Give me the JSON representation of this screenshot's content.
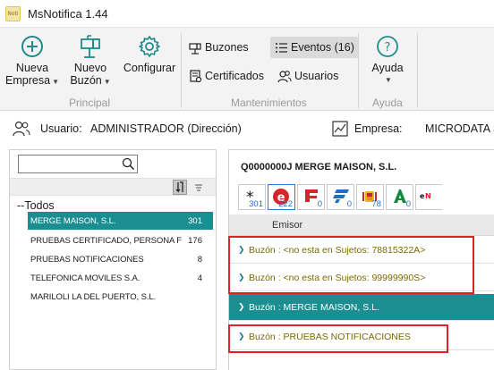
{
  "window": {
    "title": "MsNotifica 1.44",
    "icon_text": "Noti"
  },
  "ribbon": {
    "principal": {
      "label": "Principal",
      "nueva_empresa": {
        "line1": "Nueva",
        "line2": "Empresa"
      },
      "nuevo_buzon": {
        "line1": "Nuevo",
        "line2": "Buzón"
      },
      "configurar": {
        "label": "Configurar"
      }
    },
    "mantenimientos": {
      "label": "Mantenimientos",
      "buzones": "Buzones",
      "certificados": "Certificados",
      "eventos": "Eventos (16)",
      "usuarios": "Usuarios"
    },
    "ayuda": {
      "label": "Ayuda",
      "button": "Ayuda"
    }
  },
  "infobar": {
    "usuario_label": "Usuario:",
    "usuario_value": "ADMINISTRADOR (Dirección)",
    "empresa_label": "Empresa:",
    "empresa_value": "MICRODATA SC"
  },
  "left": {
    "search": {
      "value": ""
    },
    "tree_root": "--Todos",
    "entities": [
      {
        "name": "MERGE MAISON, S.L.",
        "count": "301",
        "selected": true
      },
      {
        "name": "PRUEBAS CERTIFICADO, PERSONA F",
        "count": "176",
        "selected": false
      },
      {
        "name": "PRUEBAS NOTIFICACIONES",
        "count": "8",
        "selected": false
      },
      {
        "name": "TELEFONICA MOVILES  S.A.",
        "count": "4",
        "selected": false
      },
      {
        "name": "MARILOLI LA DEL PUERTO, S.L.",
        "count": "",
        "selected": false
      }
    ]
  },
  "right": {
    "company_title": "Q0000000J  MERGE MAISON, S.L.",
    "channels": [
      {
        "icon": "asterisk-icon",
        "count": "301"
      },
      {
        "icon": "e-notificacion-icon",
        "count": "222"
      },
      {
        "icon": "seguridad-social-icon",
        "count": "0"
      },
      {
        "icon": "agencia-tributaria-icon",
        "count": "0"
      },
      {
        "icon": "spain-coat-icon",
        "count": "78"
      },
      {
        "icon": "andalucia-icon",
        "count": "0"
      },
      {
        "icon": "enotum-icon",
        "count": ""
      }
    ],
    "column_header": "Emisor",
    "messages": [
      {
        "text": "Buzón : <no esta en Sujetos: 78815322A>",
        "selected": false
      },
      {
        "text": "Buzón : <no esta en Sujetos: 99999990S>",
        "selected": false
      },
      {
        "text": "Buzón : MERGE MAISON, S.L.",
        "selected": true
      },
      {
        "text": "Buzón : PRUEBAS NOTIFICACIONES",
        "selected": false
      }
    ]
  },
  "colors": {
    "accent_teal": "#1b8e91",
    "highlight_red": "#e0202a",
    "count_blue": "#2a6fc9"
  }
}
